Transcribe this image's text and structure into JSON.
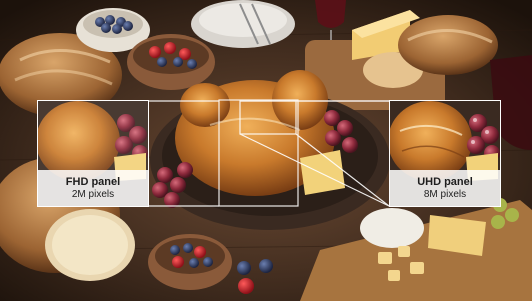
{
  "panels": {
    "left": {
      "title": "FHD panel",
      "subtitle": "2M pixels"
    },
    "right": {
      "title": "UHD panel",
      "subtitle": "8M pixels"
    }
  },
  "colors": {
    "frame": "#ffffff",
    "label_bg": "#ffffffdd",
    "label_text": "#1e1e1e"
  }
}
